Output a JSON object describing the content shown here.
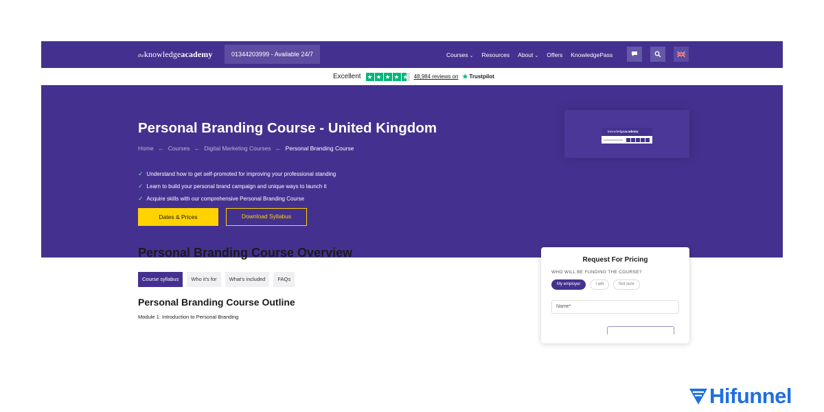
{
  "nav": {
    "logo_prefix": "the",
    "logo_main": "knowledge",
    "logo_bold": "academy",
    "phone": "01344203999 - Available 24/7",
    "menu": [
      "Courses",
      "Resources",
      "About",
      "Offers",
      "KnowledgePass"
    ],
    "icons": [
      "chat-icon",
      "search-icon",
      "uk-flag-icon"
    ]
  },
  "trustpilot": {
    "rating_text": "Excellent",
    "stars": 4.5,
    "reviews": "48,984 reviews on",
    "brand": "Trustpilot",
    "brand_color": "#00b67a"
  },
  "hero": {
    "title": "Personal Branding Course - United Kingdom",
    "breadcrumbs": [
      "Home",
      "Courses",
      "Digital Marketing Courses",
      "Personal Branding Course"
    ],
    "bullets": [
      "Understand how to get self-promoted for improving your professional standing",
      "Learn to build your personal brand campaign and unique ways to launch it",
      "Acquire skills with our comprehensive Personal Branding Course"
    ],
    "primary_button": "Dates & Prices",
    "secondary_button": "Download Syllabus",
    "bg_color": "#44318f",
    "accent_color": "#ffd200"
  },
  "overview": {
    "title": "Personal Branding Course Overview",
    "tabs": [
      "Course syllabus",
      "Who it's for",
      "What's included",
      "FAQs"
    ],
    "active_tab": "Course syllabus",
    "outline_title": "Personal Branding Course Outline",
    "module": "Module 1: Introduction to Personal Branding"
  },
  "pricing": {
    "title": "Request For Pricing",
    "label": "WHO WILL BE FUNDING THE COURSE?",
    "options": [
      "My employer",
      "I will",
      "Not sure"
    ],
    "selected": "My employer",
    "name_placeholder": "Name*"
  },
  "watermark": {
    "brand": "Hifunnel",
    "color": "#1f6fe0"
  }
}
